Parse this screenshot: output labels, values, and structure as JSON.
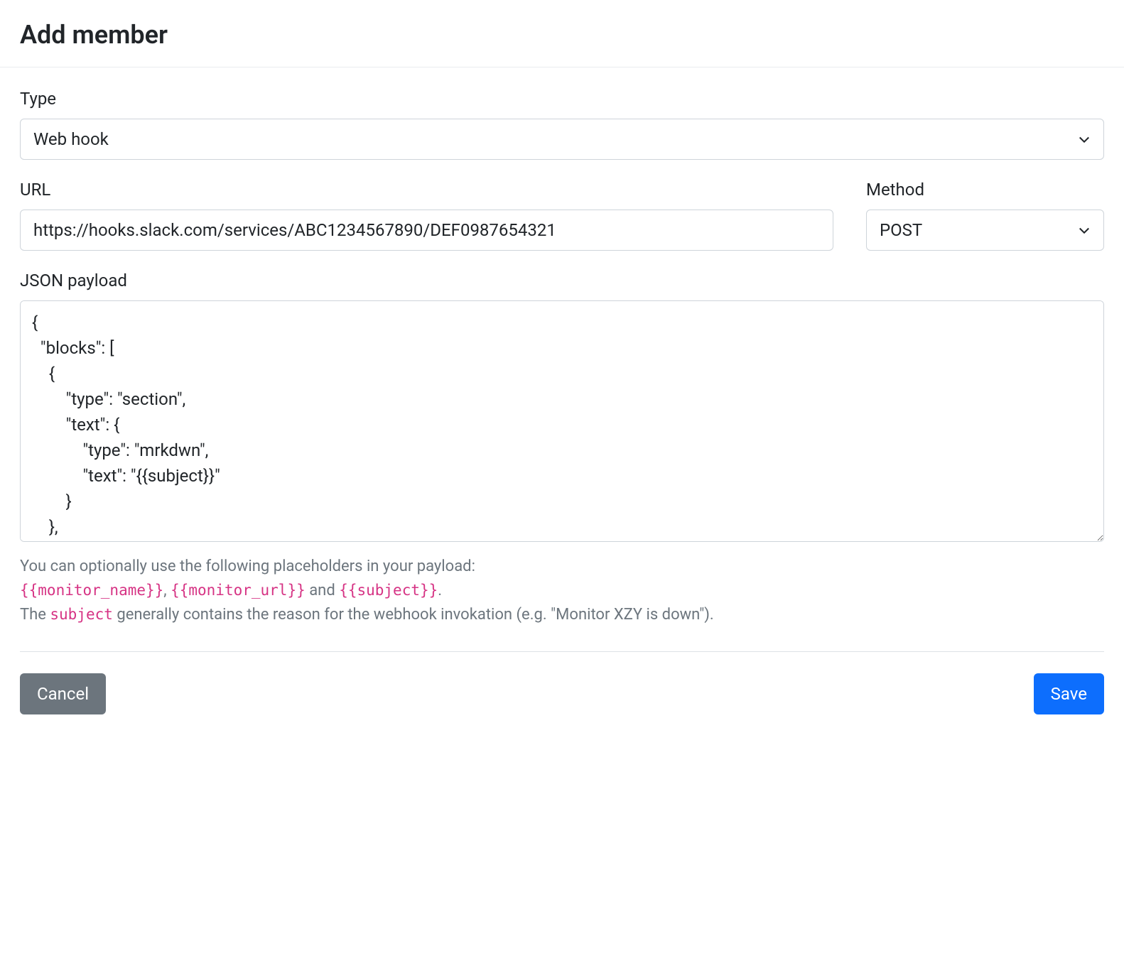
{
  "header": {
    "title": "Add member"
  },
  "form": {
    "type": {
      "label": "Type",
      "value": "Web hook"
    },
    "url": {
      "label": "URL",
      "value": "https://hooks.slack.com/services/ABC1234567890/DEF0987654321"
    },
    "method": {
      "label": "Method",
      "value": "POST"
    },
    "payload": {
      "label": "JSON payload",
      "value": "{\n  \"blocks\": [\n    {\n        \"type\": \"section\",\n        \"text\": {\n            \"type\": \"mrkdwn\",\n            \"text\": \"{{subject}}\"\n        }\n    },"
    },
    "help": {
      "line1_prefix": "You can optionally use the following placeholders in your payload:",
      "placeholder1": "{{monitor_name}}",
      "sep1": ", ",
      "placeholder2": "{{monitor_url}}",
      "sep2": " and ",
      "placeholder3": "{{subject}}",
      "period": ".",
      "line3_prefix": "The ",
      "subject_code": "subject",
      "line3_suffix": " generally contains the reason for the webhook invokation (e.g. \"Monitor XZY is down\")."
    }
  },
  "actions": {
    "cancel": "Cancel",
    "save": "Save"
  }
}
